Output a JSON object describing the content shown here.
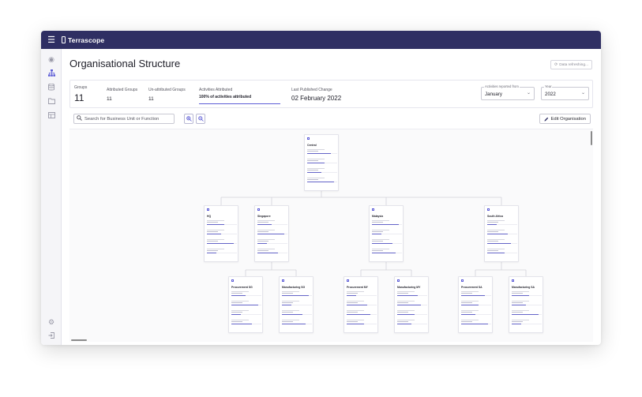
{
  "app": {
    "brand": "Terrascope"
  },
  "header": {
    "title": "Organisational Structure",
    "refresh_label": "Data refreshing..."
  },
  "stats": {
    "groups_label": "Groups",
    "groups_value": "11",
    "attributed_label": "Attributed Groups",
    "attributed_value": "11",
    "unattributed_label": "Un-attributed Groups",
    "unattributed_value": "11",
    "activities_label": "Activities Attributed",
    "activities_value": "100% of activities attributed",
    "published_label": "Last Published Change",
    "published_value": "02 February 2022"
  },
  "filters": {
    "month": {
      "label": "Activities reported from",
      "value": "January"
    },
    "year": {
      "label": "Year",
      "value": "2022"
    }
  },
  "search": {
    "placeholder": "Search for Business Unit or Function"
  },
  "toolbar": {
    "edit_label": "Edit Organisation"
  },
  "sidebar": {
    "icons": [
      "dashboard-icon",
      "org-structure-icon",
      "database-icon",
      "folder-icon",
      "table-icon",
      "settings-icon",
      "logout-icon"
    ]
  },
  "tree": {
    "root": {
      "name": "Central"
    },
    "level2": [
      {
        "name": "HQ"
      },
      {
        "name": "Singapore"
      },
      {
        "name": "Malaysia"
      },
      {
        "name": "South Africa"
      }
    ],
    "level3": [
      {
        "name": "Procurement SG"
      },
      {
        "name": "Manufacturing SG"
      },
      {
        "name": "Procurement MY"
      },
      {
        "name": "Manufacturing MY"
      },
      {
        "name": "Procurement SA"
      },
      {
        "name": "Manufacturing SA"
      }
    ]
  },
  "colors": {
    "topbar": "#2f2f63",
    "accent": "#5b5bd6"
  }
}
